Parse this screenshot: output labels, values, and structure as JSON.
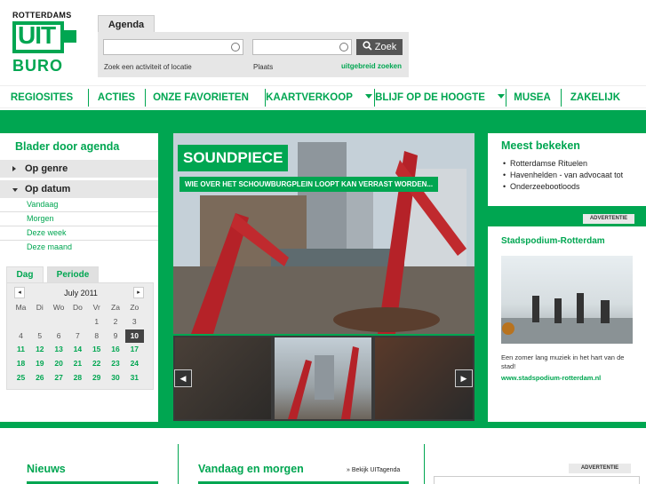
{
  "logo": {
    "top": "ROTTERDAMS",
    "uit": "UIT",
    "buro": "BURO"
  },
  "search": {
    "tab": "Agenda",
    "activity_label": "Zoek een activiteit of locatie",
    "place_label": "Plaats",
    "button": "Zoek",
    "extended": "uitgebreid zoeken"
  },
  "nav": {
    "items": [
      "REGIOSITES",
      "ACTIES",
      "ONZE FAVORIETEN",
      "KAARTVERKOOP",
      "BLIJF OP DE HOOGTE",
      "MUSEA",
      "ZAKELIJK"
    ]
  },
  "sidebar": {
    "title": "Blader door agenda",
    "op_genre": "Op genre",
    "op_datum": "Op datum",
    "dates": [
      "Vandaag",
      "Morgen",
      "Deze week",
      "Deze maand"
    ]
  },
  "calendar": {
    "tabs": [
      "Dag",
      "Periode"
    ],
    "month": "July 2011",
    "prev": "◂",
    "next": "▸",
    "weekdays": [
      "Ma",
      "Di",
      "Wo",
      "Do",
      "Vr",
      "Za",
      "Zo"
    ],
    "weeks": [
      [
        "",
        "",
        "",
        "",
        "1",
        "2",
        "3"
      ],
      [
        "4",
        "5",
        "6",
        "7",
        "8",
        "9",
        "10"
      ],
      [
        "11",
        "12",
        "13",
        "14",
        "15",
        "16",
        "17"
      ],
      [
        "18",
        "19",
        "20",
        "21",
        "22",
        "23",
        "24"
      ],
      [
        "25",
        "26",
        "27",
        "28",
        "29",
        "30",
        "31"
      ]
    ],
    "today": "10"
  },
  "hero": {
    "title": "SOUNDPIECE",
    "subtitle": "WIE OVER HET SCHOUWBURGPLEIN LOOPT KAN VERRAST WORDEN..."
  },
  "meest": {
    "title": "Meest bekeken",
    "items": [
      "Rotterdamse Rituelen",
      "Havenhelden - van advocaat tot",
      "Onderzeebootloods"
    ]
  },
  "advertentie": "ADVERTENTIE",
  "stadspodium": {
    "title": "Stadspodium-Rotterdam",
    "text": "Een zomer lang muziek in het hart van de stad!",
    "link": "www.stadspodium-rotterdam.nl"
  },
  "bottom": {
    "nieuws": "Nieuws",
    "vandaag": "Vandaag en morgen",
    "bekijk": "» Bekijk UITagenda"
  },
  "colors": {
    "brand_green": "#00a651"
  }
}
